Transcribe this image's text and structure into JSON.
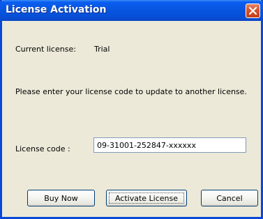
{
  "window": {
    "title": "License Activation"
  },
  "current_license": {
    "label": "Current license:",
    "value": "Trial"
  },
  "instruction": "Please enter your license code to update to another license.",
  "license_code": {
    "label": "License code :",
    "value": "09-31001-252847-xxxxxx"
  },
  "buttons": {
    "buy_now": "Buy Now",
    "activate": "Activate License",
    "cancel": "Cancel"
  },
  "colors": {
    "titlebar": "#0855e0",
    "dialog_background": "#ece9d8",
    "close_button": "#d8532e"
  },
  "icons": {
    "close": "close-icon"
  }
}
